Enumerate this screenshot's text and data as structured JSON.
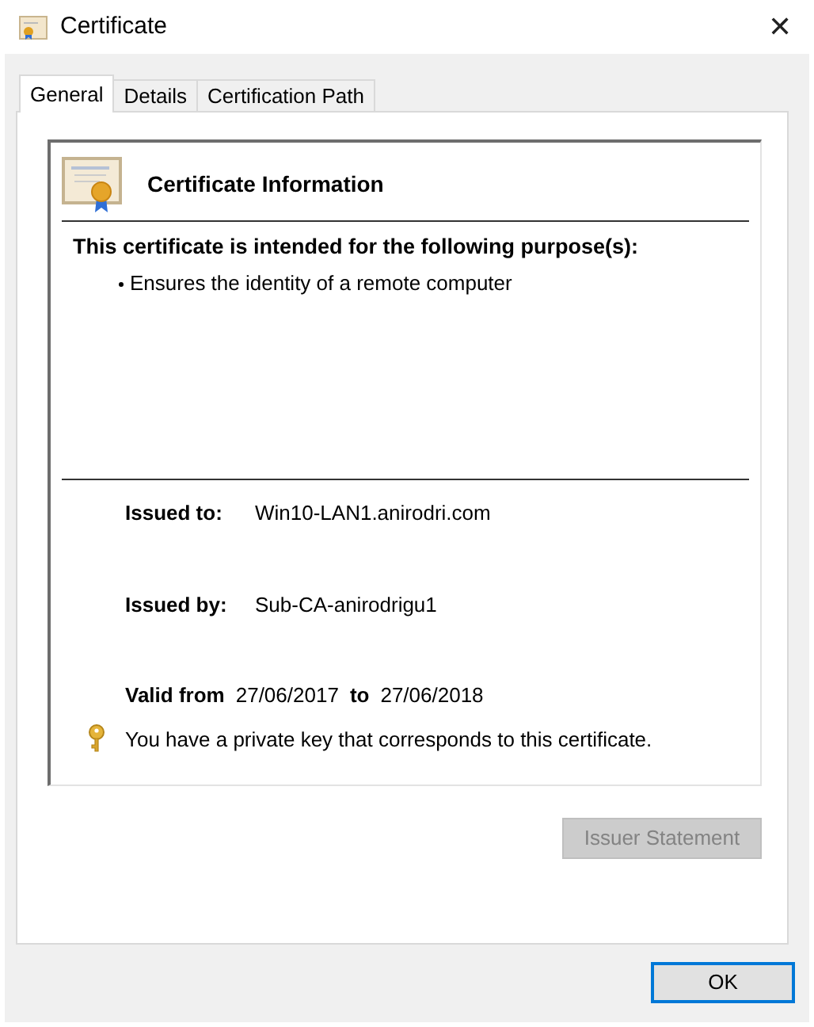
{
  "window": {
    "title": "Certificate",
    "close": "✕"
  },
  "tabs": [
    {
      "label": "General",
      "selected": true
    },
    {
      "label": "Details",
      "selected": false
    },
    {
      "label": "Certification Path",
      "selected": false
    }
  ],
  "info": {
    "heading": "Certificate Information",
    "purpose_heading": "This certificate is intended for the following purpose(s):",
    "purposes": [
      "Ensures the identity of a remote computer"
    ],
    "issued_to": {
      "label": "Issued to:",
      "value": "Win10-LAN1.anirodri.com"
    },
    "issued_by": {
      "label": "Issued by:",
      "value": "Sub-CA-anirodrigu1"
    },
    "valid": {
      "from_label": "Valid from",
      "from": "27/06/2017",
      "to_label": "to",
      "to": "27/06/2018"
    },
    "key_note": "You have a private key that corresponds to this certificate."
  },
  "issuer_statement": {
    "label": "Issuer Statement",
    "disabled": true
  },
  "ok": {
    "label": "OK",
    "focused": true
  }
}
